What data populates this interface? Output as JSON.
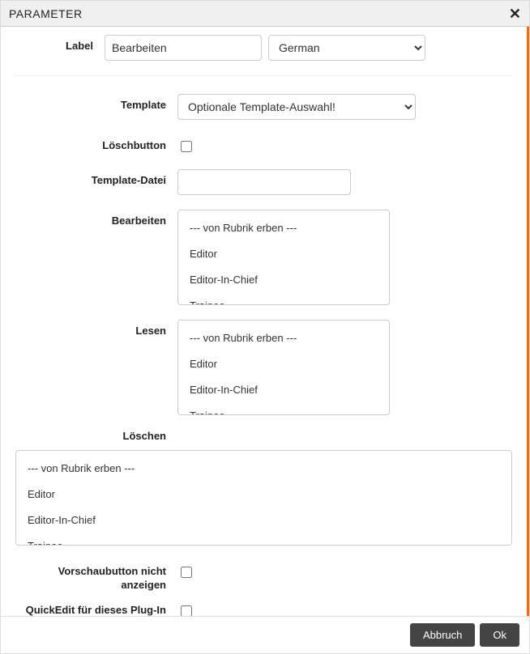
{
  "dialog": {
    "title": "PARAMETER"
  },
  "labels": {
    "label": "Label",
    "template": "Template",
    "deleteButton": "Löschbutton",
    "templateFile": "Template-Datei",
    "edit": "Bearbeiten",
    "read": "Lesen",
    "delete": "Löschen",
    "previewHide": "Vorschaubutton nicht anzeigen",
    "quickeditDisable": "QuickEdit für dieses Plug-In deaktivieren"
  },
  "fields": {
    "labelValue": "Bearbeiten",
    "languageValue": "German",
    "languageOptions": [
      "German"
    ],
    "templateValue": "Optionale Template-Auswahl!",
    "templateOptions": [
      "Optionale Template-Auswahl!"
    ],
    "templateFileValue": ""
  },
  "roleOptions": {
    "items": [
      "--- von Rubrik erben ---",
      "Editor",
      "Editor-In-Chief",
      "Trainee"
    ]
  },
  "footer": {
    "cancel": "Abbruch",
    "ok": "Ok"
  }
}
